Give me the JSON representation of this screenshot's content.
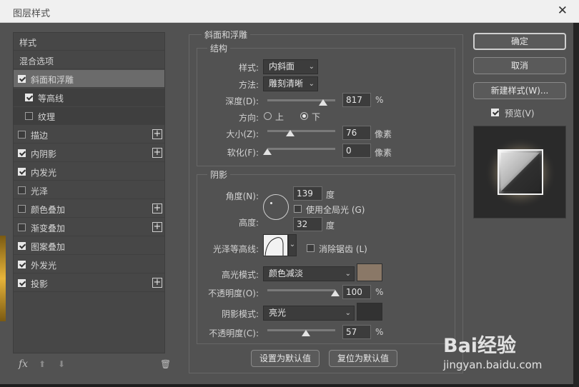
{
  "window": {
    "title": "图层样式",
    "close_glyph": "✕"
  },
  "style_list": {
    "items": [
      {
        "label": "样式",
        "checkbox": false,
        "checked": false,
        "plus": false,
        "kind": "header"
      },
      {
        "label": "混合选项",
        "checkbox": false,
        "checked": false,
        "plus": false,
        "kind": "header"
      },
      {
        "label": "斜面和浮雕",
        "checkbox": true,
        "checked": true,
        "plus": false,
        "kind": "selected"
      },
      {
        "label": "等高线",
        "checkbox": true,
        "checked": true,
        "plus": false,
        "kind": "sub"
      },
      {
        "label": "纹理",
        "checkbox": true,
        "checked": false,
        "plus": false,
        "kind": "sub"
      },
      {
        "label": "描边",
        "checkbox": true,
        "checked": false,
        "plus": true,
        "kind": "normal"
      },
      {
        "label": "内阴影",
        "checkbox": true,
        "checked": true,
        "plus": true,
        "kind": "normal"
      },
      {
        "label": "内发光",
        "checkbox": true,
        "checked": true,
        "plus": false,
        "kind": "normal"
      },
      {
        "label": "光泽",
        "checkbox": true,
        "checked": false,
        "plus": false,
        "kind": "normal"
      },
      {
        "label": "颜色叠加",
        "checkbox": true,
        "checked": false,
        "plus": true,
        "kind": "normal"
      },
      {
        "label": "渐变叠加",
        "checkbox": true,
        "checked": false,
        "plus": true,
        "kind": "normal"
      },
      {
        "label": "图案叠加",
        "checkbox": true,
        "checked": true,
        "plus": false,
        "kind": "normal"
      },
      {
        "label": "外发光",
        "checkbox": true,
        "checked": true,
        "plus": false,
        "kind": "normal"
      },
      {
        "label": "投影",
        "checkbox": true,
        "checked": true,
        "plus": true,
        "kind": "normal"
      }
    ],
    "fx_label": "fx",
    "up_glyph": "⬆",
    "down_glyph": "⬇",
    "trash_glyph": "🗑"
  },
  "bevel": {
    "section_title": "斜面和浮雕",
    "structure": {
      "title": "结构",
      "style_label": "样式:",
      "style_value": "内斜面",
      "method_label": "方法:",
      "method_value": "雕刻清晰",
      "depth_label": "深度(D):",
      "depth_value": "817",
      "depth_unit": "%",
      "depth_level": 0.82,
      "direction_label": "方向:",
      "dir_up": "上",
      "dir_down": "下",
      "direction_selected": "下",
      "size_label": "大小(Z):",
      "size_value": "76",
      "size_unit": "像素",
      "size_level": 0.34,
      "soften_label": "软化(F):",
      "soften_value": "0",
      "soften_unit": "像素",
      "soften_level": 0.0
    },
    "shading": {
      "title": "阴影",
      "angle_label": "角度(N):",
      "angle_value": "139",
      "angle_unit": "度",
      "global_light_label": "使用全局光 (G)",
      "global_light_checked": false,
      "altitude_label": "高度:",
      "altitude_value": "32",
      "altitude_unit": "度",
      "gloss_label": "光泽等高线:",
      "antialias_label": "消除锯齿 (L)",
      "antialias_checked": false,
      "highlight_label": "高光模式:",
      "highlight_mode": "颜色减淡",
      "highlight_color": "#8a7867",
      "highlight_opacity_label": "不透明度(O):",
      "highlight_opacity": "100",
      "highlight_opacity_level": 1.0,
      "shadow_label": "阴影模式:",
      "shadow_mode": "亮光",
      "shadow_color": "#323232",
      "shadow_opacity_label": "不透明度(C):",
      "shadow_opacity": "57",
      "shadow_opacity_level": 0.57,
      "pct": "%"
    },
    "set_default": "设置为默认值",
    "reset_default": "复位为默认值"
  },
  "buttons": {
    "ok": "确定",
    "cancel": "取消",
    "new_style": "新建样式(W)...",
    "preview_label": "预览(V)",
    "preview_checked": true
  },
  "watermark": {
    "brand": "Bai经验",
    "url": "jingyan.baidu.com"
  }
}
